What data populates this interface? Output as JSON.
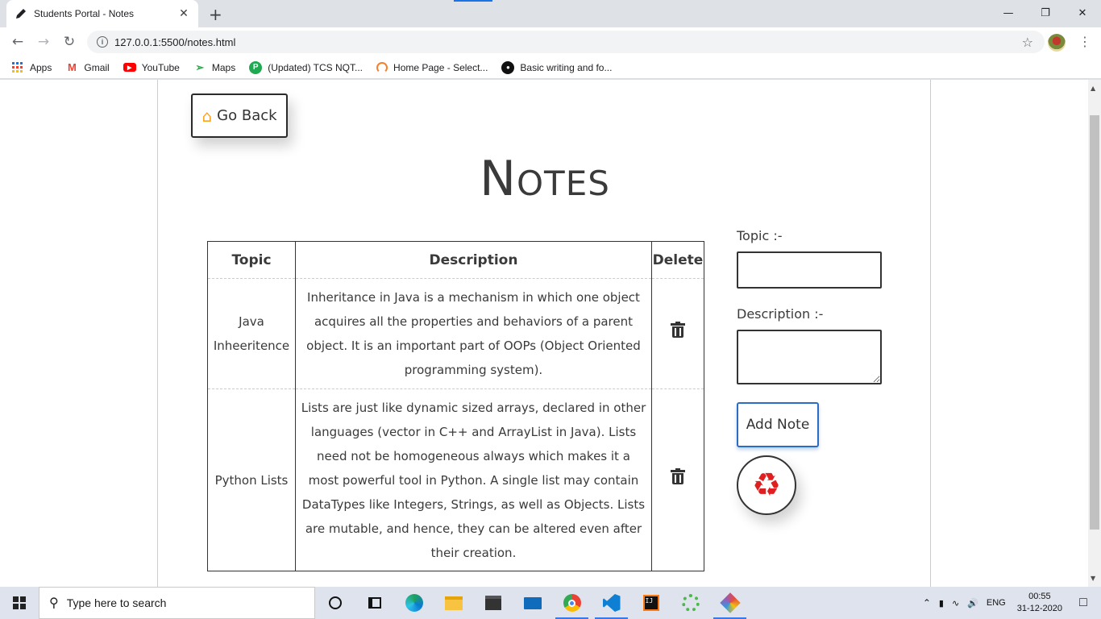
{
  "browser": {
    "tab_title": "Students Portal - Notes",
    "tab_close": "✕",
    "new_tab": "+",
    "url": "127.0.0.1:5500/notes.html",
    "window_controls": {
      "minimize": "—",
      "restore": "❐",
      "close": "✕"
    }
  },
  "bookmarks": [
    {
      "label": "Apps",
      "icon": "apps-grid-icon"
    },
    {
      "label": "Gmail",
      "icon": "gmail-icon"
    },
    {
      "label": "YouTube",
      "icon": "youtube-icon"
    },
    {
      "label": "Maps",
      "icon": "maps-icon"
    },
    {
      "label": "(Updated) TCS NQT...",
      "icon": "tcs-icon"
    },
    {
      "label": "Home Page - Select...",
      "icon": "select-icon"
    },
    {
      "label": "Basic writing and fo...",
      "icon": "github-icon"
    }
  ],
  "page": {
    "go_back_label": "Go Back",
    "title": "Notes",
    "table": {
      "headers": {
        "topic": "Topic",
        "description": "Description",
        "delete": "Delete"
      },
      "rows": [
        {
          "topic": "Java Inheeritence",
          "description": "Inheritance in Java is a mechanism in which one object acquires all the properties and behaviors of a parent object. It is an important part of OOPs (Object Oriented programming system)."
        },
        {
          "topic": "Python Lists",
          "description": "Lists are just like dynamic sized arrays, declared in other languages (vector in C++ and ArrayList in Java). Lists need not be homogeneous always which makes it a most powerful tool in Python. A single list may contain DataTypes like Integers, Strings, as well as Objects. Lists are mutable, and hence, they can be altered even after their creation."
        }
      ]
    },
    "form": {
      "topic_label": "Topic :-",
      "topic_value": "",
      "description_label": "Description :-",
      "description_value": "",
      "add_label": "Add Note"
    }
  },
  "taskbar": {
    "search_placeholder": "Type here to search",
    "language": "ENG",
    "time": "00:55",
    "date": "31-12-2020"
  },
  "colors": {
    "accent_blue": "#2b6cc4",
    "home_icon": "#f5a623",
    "recycle_icon": "#e02020"
  }
}
